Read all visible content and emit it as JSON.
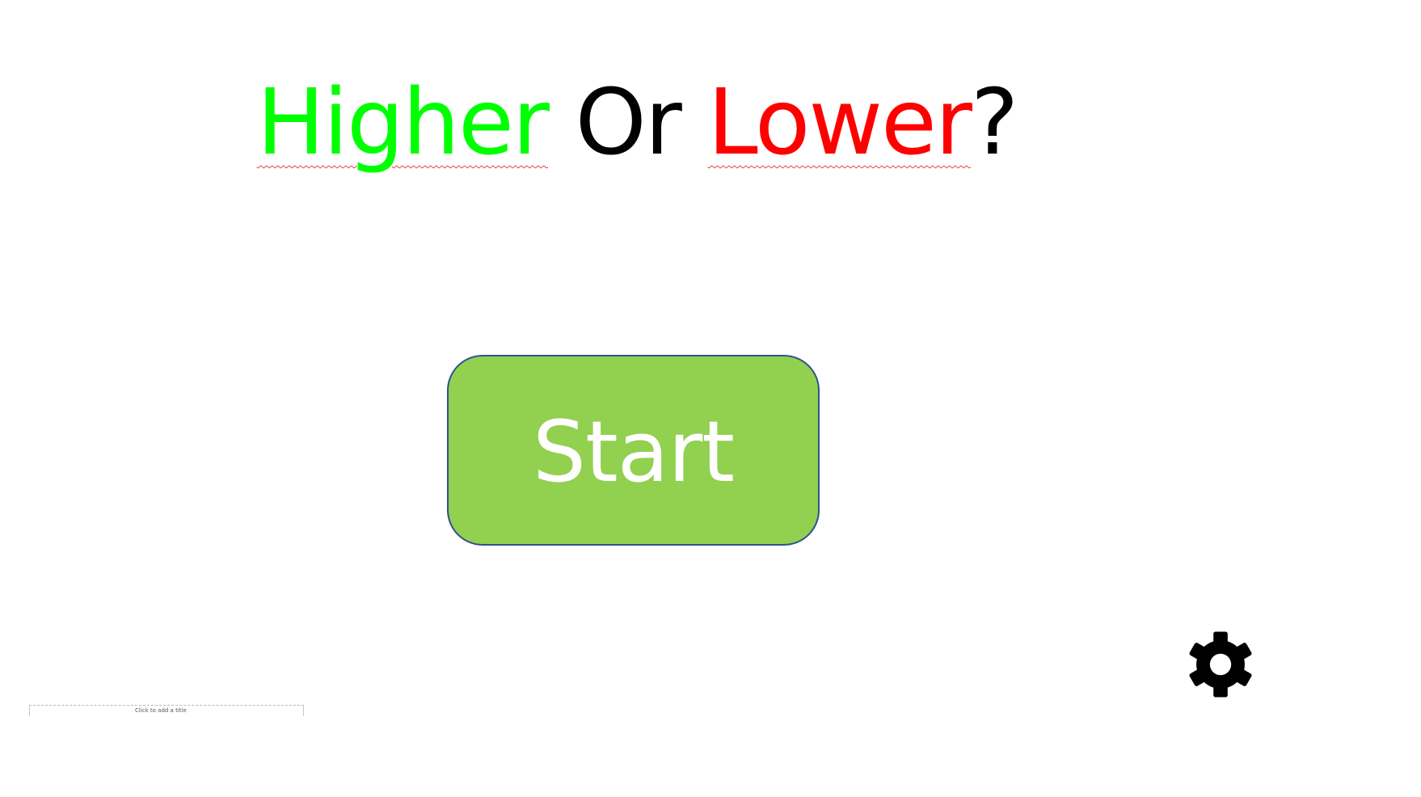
{
  "title": {
    "word_higher": "Higher",
    "word_or": "Or",
    "word_lower": "Lower",
    "question_mark": "?"
  },
  "start_button": {
    "label": "Start"
  },
  "settings": {
    "icon": "gear-icon"
  },
  "hint": {
    "text": "Click to add a title"
  },
  "colors": {
    "higher": "#00ff00",
    "lower": "#ff0000",
    "neutral": "#000000",
    "button_fill": "#92d050",
    "button_border": "#2f528f",
    "button_text": "#ffffff"
  }
}
